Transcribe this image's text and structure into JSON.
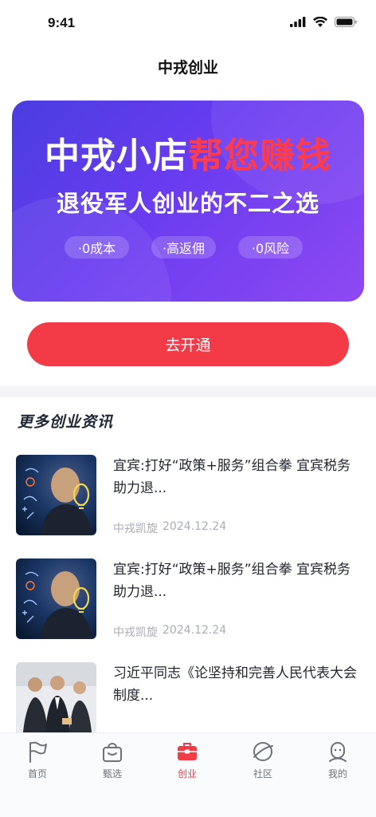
{
  "status": {
    "time": "9:41"
  },
  "nav": {
    "title": "中戎创业"
  },
  "banner": {
    "title_white": "中戎小店",
    "title_red": "帮您赚钱",
    "subtitle": "退役军人创业的不二之选",
    "tags": [
      "·0成本",
      "·高返佣",
      "·0风险"
    ],
    "accent_color": "#ff3b4d"
  },
  "cta": {
    "label": "去开通",
    "color": "#f33a47"
  },
  "section": {
    "title": "更多创业资讯"
  },
  "news": [
    {
      "title": "宜宾:打好“政策+服务”组合拳 宜宾税务助力退...",
      "source": "中戎凯旋",
      "date": "2024.12.24",
      "thumb": "businessman-idea-bulb"
    },
    {
      "title": "宜宾:打好“政策+服务”组合拳 宜宾税务助力退...",
      "source": "中戎凯旋",
      "date": "2024.12.24",
      "thumb": "businessman-idea-bulb"
    },
    {
      "title": "习近平同志《论坚持和完善人民代表大会制度...",
      "source": "",
      "date": "",
      "thumb": "business-team-photo"
    }
  ],
  "tabs": [
    {
      "label": "首页",
      "icon": "flag-icon",
      "active": false
    },
    {
      "label": "甄选",
      "icon": "basket-icon",
      "active": false
    },
    {
      "label": "创业",
      "icon": "briefcase-icon",
      "active": true
    },
    {
      "label": "社区",
      "icon": "planet-icon",
      "active": false
    },
    {
      "label": "我的",
      "icon": "profile-icon",
      "active": false
    }
  ]
}
